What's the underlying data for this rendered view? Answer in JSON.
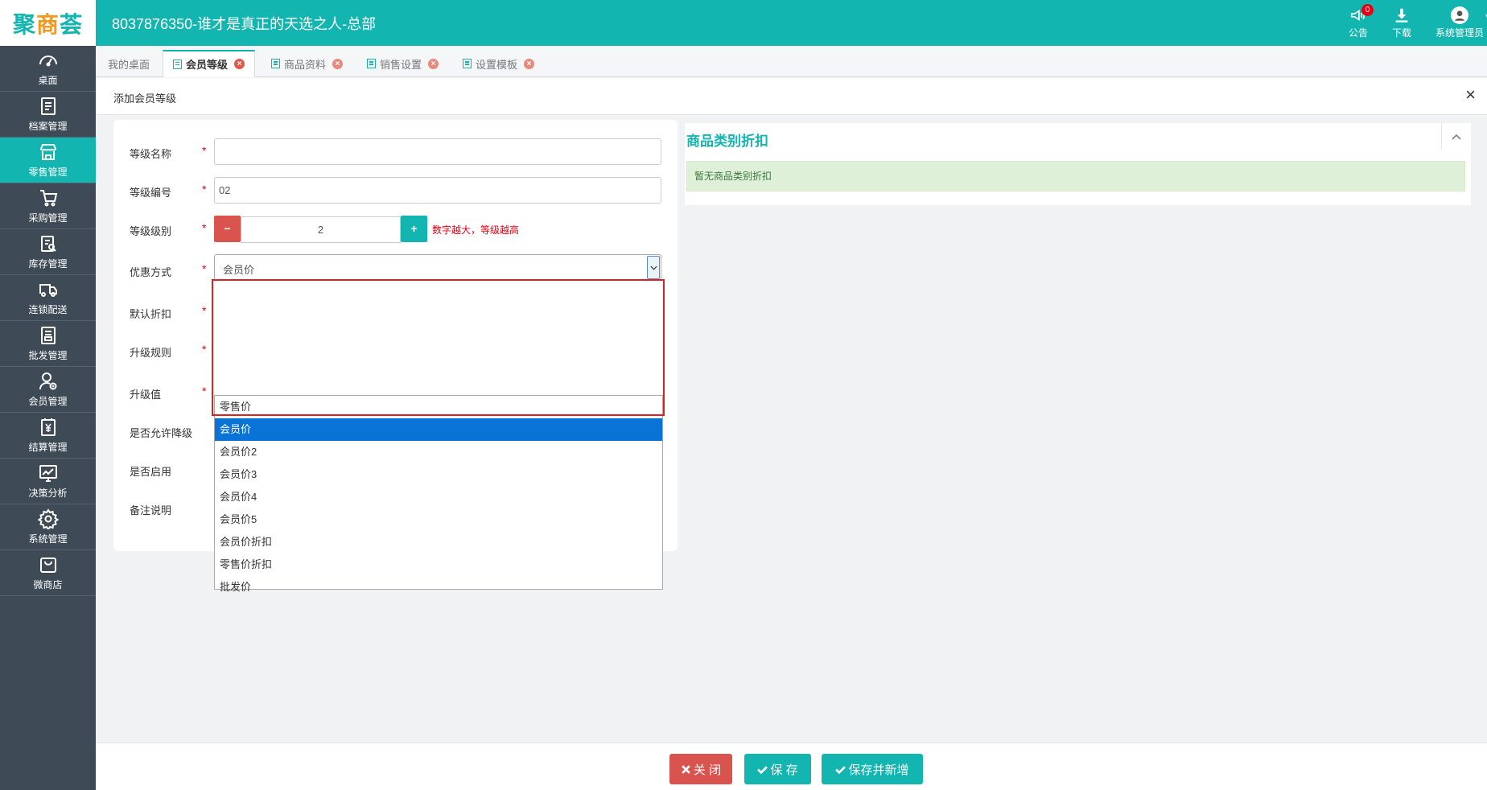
{
  "header": {
    "logo": {
      "part1": "聚",
      "part2": "商",
      "part3": "荟"
    },
    "title": "8037876350-谁才是真正的天选之人-总部",
    "notice_label": "公告",
    "notice_count": "0",
    "download_label": "下载",
    "user_label": "系统管理员"
  },
  "sidebar": {
    "items": [
      {
        "label": "桌面",
        "icon": "dashboard-icon"
      },
      {
        "label": "档案管理",
        "icon": "archive-icon"
      },
      {
        "label": "零售管理",
        "icon": "store-icon",
        "active": true
      },
      {
        "label": "采购管理",
        "icon": "cart-icon"
      },
      {
        "label": "库存管理",
        "icon": "inventory-icon"
      },
      {
        "label": "连锁配送",
        "icon": "truck-icon"
      },
      {
        "label": "批发管理",
        "icon": "wholesale-icon"
      },
      {
        "label": "会员管理",
        "icon": "member-icon"
      },
      {
        "label": "结算管理",
        "icon": "yen-icon"
      },
      {
        "label": "决策分析",
        "icon": "chart-icon"
      },
      {
        "label": "系统管理",
        "icon": "gear-icon"
      },
      {
        "label": "微商店",
        "icon": "bag-icon"
      }
    ]
  },
  "tabs": [
    {
      "label": "我的桌面"
    },
    {
      "label": "会员等级",
      "active": true
    },
    {
      "label": "商品资料"
    },
    {
      "label": "销售设置"
    },
    {
      "label": "设置模板"
    }
  ],
  "page": {
    "title": "添加会员等级",
    "close_symbol": "×"
  },
  "form": {
    "name_label": "等级名称",
    "name_value": "",
    "code_label": "等级编号",
    "code_value": "02",
    "level_label": "等级级别",
    "level_value": "2",
    "level_minus": "−",
    "level_plus": "+",
    "level_hint": "数字越大，等级越高",
    "discount_mode_label": "优惠方式",
    "discount_mode_value": "会员价",
    "default_discount_label": "默认折扣",
    "upgrade_rule_label": "升级规则",
    "upgrade_value_label": "升级值",
    "allow_downgrade_label": "是否允许降级",
    "enabled_label": "是否启用",
    "remarks_label": "备注说明",
    "required_mark": "*"
  },
  "dropdown": {
    "options": [
      "零售价",
      "会员价",
      "会员价2",
      "会员价3",
      "会员价4",
      "会员价5",
      "会员价折扣",
      "零售价折扣",
      "批发价"
    ],
    "selected_index": 1
  },
  "category_panel": {
    "title": "商品类别折扣",
    "empty_message": "暂无商品类别折扣"
  },
  "footer": {
    "close_label": "关 闭",
    "save_label": "保 存",
    "save_new_label": "保存并新增"
  },
  "colors": {
    "brand": "#12b5b0",
    "sidebar": "#3e4a56",
    "danger": "#d9534f",
    "select_highlight": "#0a74d6",
    "frame": "#e02020"
  }
}
